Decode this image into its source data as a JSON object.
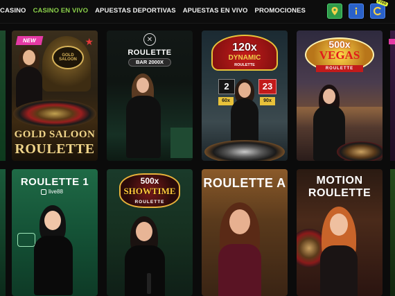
{
  "nav": {
    "items": [
      {
        "label": "CASINO",
        "active": false
      },
      {
        "label": "CASINO EN VIVO",
        "active": true
      },
      {
        "label": "APUESTAS DEPORTIVAS",
        "active": false
      },
      {
        "label": "APUESTAS EN VIVO",
        "active": false
      },
      {
        "label": "PROMOCIONES",
        "active": false
      }
    ],
    "accent_color": "#8bd14a"
  },
  "top_icons": [
    {
      "name": "location-icon"
    },
    {
      "name": "info-icon"
    },
    {
      "name": "free-spins-icon",
      "badge": "Free"
    }
  ],
  "games_row1": [
    {
      "badge": "NEW",
      "title_line1": "GOLD SALOON",
      "title_line2": "ROULETTE",
      "logo_text": "GOLD SALOON"
    },
    {
      "title": "ROULETTE",
      "subtitle": "BAR 2000X"
    },
    {
      "title_top": "120x",
      "title": "DYNAMIC",
      "subtitle": "ROULETTE",
      "num_left": "2",
      "num_right": "23",
      "mult_left": "60x",
      "mult_right": "90x"
    },
    {
      "title_top": "500x",
      "title": "VEGAS",
      "subtitle": "ROULETTE"
    }
  ],
  "games_row2": [
    {
      "title": "ROULETTE 1",
      "provider": "live88"
    },
    {
      "title_top": "500x",
      "title": "SHOWTIME",
      "subtitle": "ROULETTE"
    },
    {
      "title": "ROULETTE A"
    },
    {
      "title_line1": "MOTION",
      "title_line2": "ROULETTE"
    }
  ]
}
